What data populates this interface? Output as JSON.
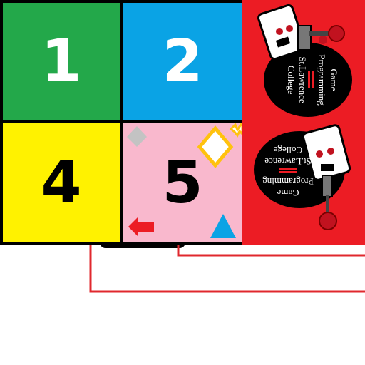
{
  "tiles": [
    {
      "id": 1,
      "label": "1",
      "color": "#23a84a",
      "text_color": "#ffffff"
    },
    {
      "id": 2,
      "label": "2",
      "color": "#0aa3e5",
      "text_color": "#ffffff"
    },
    {
      "id": 3,
      "label": "",
      "color": "#ec1c24"
    },
    {
      "id": 4,
      "label": "4",
      "color": "#fff200",
      "text_color": "#000000"
    },
    {
      "id": 5,
      "label": "5",
      "color": "#f9b8cd",
      "text_color": "#000000"
    },
    {
      "id": 6,
      "label": "",
      "color": "#ec1c24"
    }
  ],
  "logo": {
    "line1": "Game",
    "line2": "Programming",
    "line3": "St.Lawrence",
    "line4": "College"
  },
  "pieces": {
    "gray_diamond": "#c3c3c3",
    "white_diamond_outline": "#ffc20e",
    "red_arrow": "#ec1c24",
    "blue_triangle": "#0aa3e5",
    "star": "#ffc20e"
  },
  "wire_color": "#e0282e"
}
